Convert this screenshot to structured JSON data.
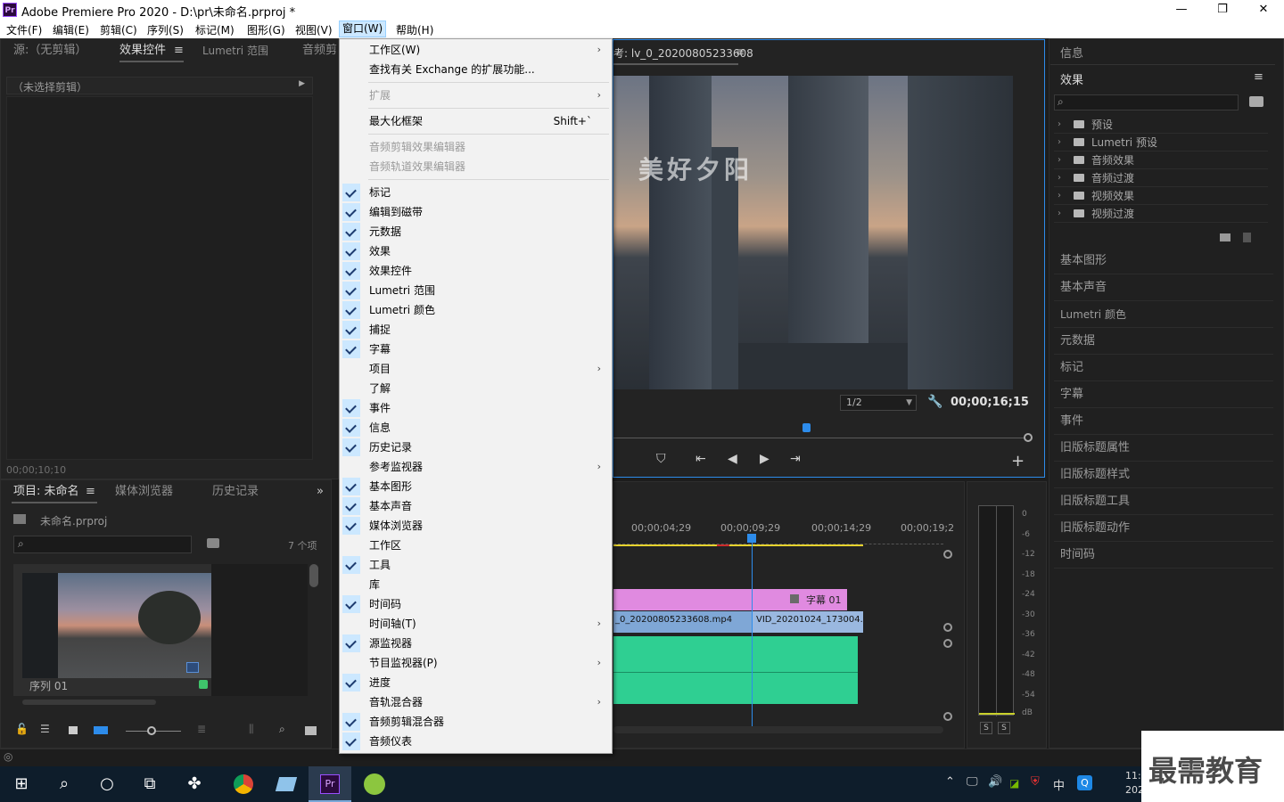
{
  "window": {
    "title": "Adobe Premiere Pro 2020 - D:\\pr\\未命名.prproj *",
    "logo": "Pr",
    "minimize": "—",
    "restore": "❐",
    "close": "✕"
  },
  "menubar": [
    "文件(F)",
    "编辑(E)",
    "剪辑(C)",
    "序列(S)",
    "标记(M)",
    "图形(G)",
    "视图(V)",
    "窗口(W)",
    "帮助(H)"
  ],
  "source_panel": {
    "tabs": [
      "源:（无剪辑）",
      "效果控件",
      "Lumetri 范围",
      "音频剪"
    ],
    "menu_icon": "≡",
    "no_clip": "（未选择剪辑）",
    "timecode": "00;00;10;10"
  },
  "program_monitor": {
    "title": "考: lv_0_20200805233608",
    "overlay_text": "美好夕阳",
    "zoom": "1/2",
    "timecode": "00;00;16;15"
  },
  "window_menu": {
    "items": [
      {
        "label": "工作区(W)",
        "check": false,
        "arrow": true,
        "disabled": false
      },
      {
        "label": "查找有关 Exchange 的扩展功能...",
        "check": false,
        "arrow": false,
        "disabled": false
      },
      {
        "sep": true
      },
      {
        "label": "扩展",
        "check": false,
        "arrow": true,
        "disabled": true
      },
      {
        "sep": true
      },
      {
        "label": "最大化框架",
        "check": false,
        "arrow": false,
        "disabled": false,
        "shortcut": "Shift+`"
      },
      {
        "sep": true
      },
      {
        "label": "音频剪辑效果编辑器",
        "check": false,
        "arrow": false,
        "disabled": true
      },
      {
        "label": "音频轨道效果编辑器",
        "check": false,
        "arrow": false,
        "disabled": true
      },
      {
        "sep": true
      },
      {
        "label": "标记",
        "check": true,
        "arrow": false,
        "disabled": false
      },
      {
        "label": "编辑到磁带",
        "check": true,
        "arrow": false,
        "disabled": false
      },
      {
        "label": "元数据",
        "check": true,
        "arrow": false,
        "disabled": false
      },
      {
        "label": "效果",
        "check": true,
        "arrow": false,
        "disabled": false
      },
      {
        "label": "效果控件",
        "check": true,
        "arrow": false,
        "disabled": false
      },
      {
        "label": "Lumetri 范围",
        "check": true,
        "arrow": false,
        "disabled": false
      },
      {
        "label": "Lumetri 颜色",
        "check": true,
        "arrow": false,
        "disabled": false
      },
      {
        "label": "捕捉",
        "check": true,
        "arrow": false,
        "disabled": false
      },
      {
        "label": "字幕",
        "check": true,
        "arrow": false,
        "disabled": false
      },
      {
        "label": "项目",
        "check": false,
        "arrow": true,
        "disabled": false
      },
      {
        "label": "了解",
        "check": false,
        "arrow": false,
        "disabled": false
      },
      {
        "label": "事件",
        "check": true,
        "arrow": false,
        "disabled": false
      },
      {
        "label": "信息",
        "check": true,
        "arrow": false,
        "disabled": false
      },
      {
        "label": "历史记录",
        "check": true,
        "arrow": false,
        "disabled": false
      },
      {
        "label": "参考监视器",
        "check": false,
        "arrow": true,
        "disabled": false
      },
      {
        "label": "基本图形",
        "check": true,
        "arrow": false,
        "disabled": false
      },
      {
        "label": "基本声音",
        "check": true,
        "arrow": false,
        "disabled": false
      },
      {
        "label": "媒体浏览器",
        "check": true,
        "arrow": false,
        "disabled": false
      },
      {
        "label": "工作区",
        "check": false,
        "arrow": false,
        "disabled": false
      },
      {
        "label": "工具",
        "check": true,
        "arrow": false,
        "disabled": false
      },
      {
        "label": "库",
        "check": false,
        "arrow": false,
        "disabled": false
      },
      {
        "label": "时间码",
        "check": true,
        "arrow": false,
        "disabled": false
      },
      {
        "label": "时间轴(T)",
        "check": false,
        "arrow": true,
        "disabled": false
      },
      {
        "label": "源监视器",
        "check": true,
        "arrow": false,
        "disabled": false
      },
      {
        "label": "节目监视器(P)",
        "check": false,
        "arrow": true,
        "disabled": false
      },
      {
        "label": "进度",
        "check": true,
        "arrow": false,
        "disabled": false
      },
      {
        "label": "音轨混合器",
        "check": false,
        "arrow": true,
        "disabled": false
      },
      {
        "label": "音频剪辑混合器",
        "check": true,
        "arrow": false,
        "disabled": false
      },
      {
        "label": "音频仪表",
        "check": true,
        "arrow": false,
        "disabled": false
      }
    ]
  },
  "project_panel": {
    "tabs": [
      "项目: 未命名",
      "媒体浏览器",
      "历史记录"
    ],
    "expand": "»",
    "file": "未命名.prproj",
    "count": "7 个项",
    "sequence": "序列 01"
  },
  "timeline": {
    "ruler": [
      "00;00;04;29",
      "00;00;09;29",
      "00;00;14;29",
      "00;00;19;2"
    ],
    "title_clip": "字幕 01",
    "video_clip_a": "_0_20200805233608.mp4",
    "video_clip_b": "VID_20201024_173004.",
    "colors": {
      "title_clip": "#e08ae0",
      "video_clip": "#7fa7d6",
      "audio_clip": "#2fcf92",
      "playhead": "#2d8ceb"
    }
  },
  "meter": {
    "ticks": [
      "0",
      "-6",
      "-12",
      "-18",
      "-24",
      "-30",
      "-36",
      "-42",
      "-48",
      "-54",
      "dB"
    ],
    "buttons": [
      "S",
      "S"
    ]
  },
  "right_panel": {
    "info": "信息",
    "effects": "效果",
    "menu_icon": "≡",
    "tree": [
      "预设",
      "Lumetri 预设",
      "音频效果",
      "音频过渡",
      "视频效果",
      "视频过渡"
    ],
    "items": [
      "基本图形",
      "基本声音",
      "Lumetri 颜色",
      "元数据",
      "标记",
      "字幕",
      "事件",
      "旧版标题属性",
      "旧版标题样式",
      "旧版标题工具",
      "旧版标题动作",
      "时间码"
    ]
  },
  "taskbar": {
    "clock": "11:",
    "date": "202",
    "ime": "中",
    "watermark": "最需教育"
  }
}
